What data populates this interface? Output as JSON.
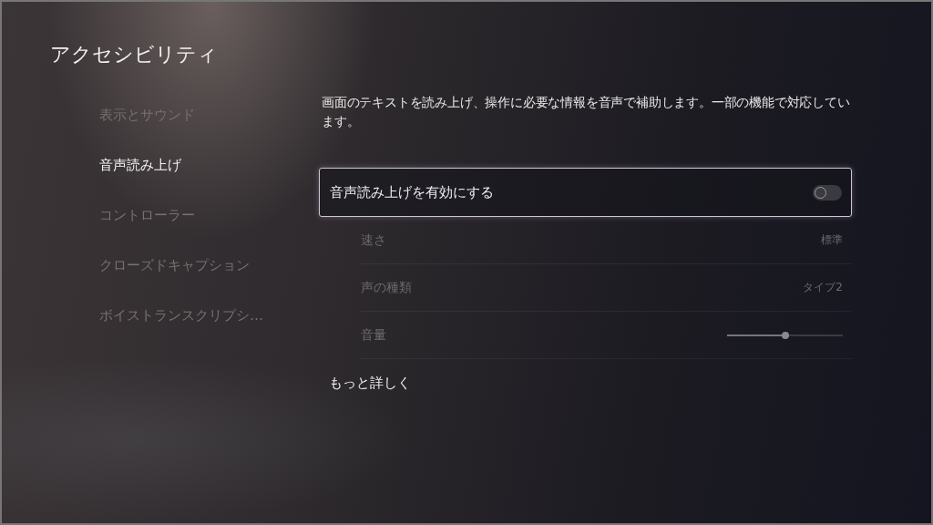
{
  "title": "アクセシビリティ",
  "sidebar": {
    "items": [
      {
        "label": "表示とサウンド",
        "selected": false
      },
      {
        "label": "音声読み上げ",
        "selected": true
      },
      {
        "label": "コントローラー",
        "selected": false
      },
      {
        "label": "クローズドキャプション",
        "selected": false
      },
      {
        "label": "ボイストランスクリプシ…",
        "selected": false
      }
    ]
  },
  "description": "画面のテキストを読み上げ、操作に必要な情報を音声で補助します。一部の機能で対応しています。",
  "settings": [
    {
      "kind": "toggle",
      "label": "音声読み上げを有効にする",
      "on": false,
      "focused": true,
      "disabled": false
    },
    {
      "kind": "value",
      "label": "速さ",
      "value": "標準",
      "disabled": true
    },
    {
      "kind": "value",
      "label": "声の種類",
      "value": "タイプ2",
      "disabled": true
    },
    {
      "kind": "slider",
      "label": "音量",
      "level": 0.5,
      "disabled": true
    },
    {
      "kind": "link",
      "label": "もっと詳しく",
      "disabled": false
    }
  ]
}
